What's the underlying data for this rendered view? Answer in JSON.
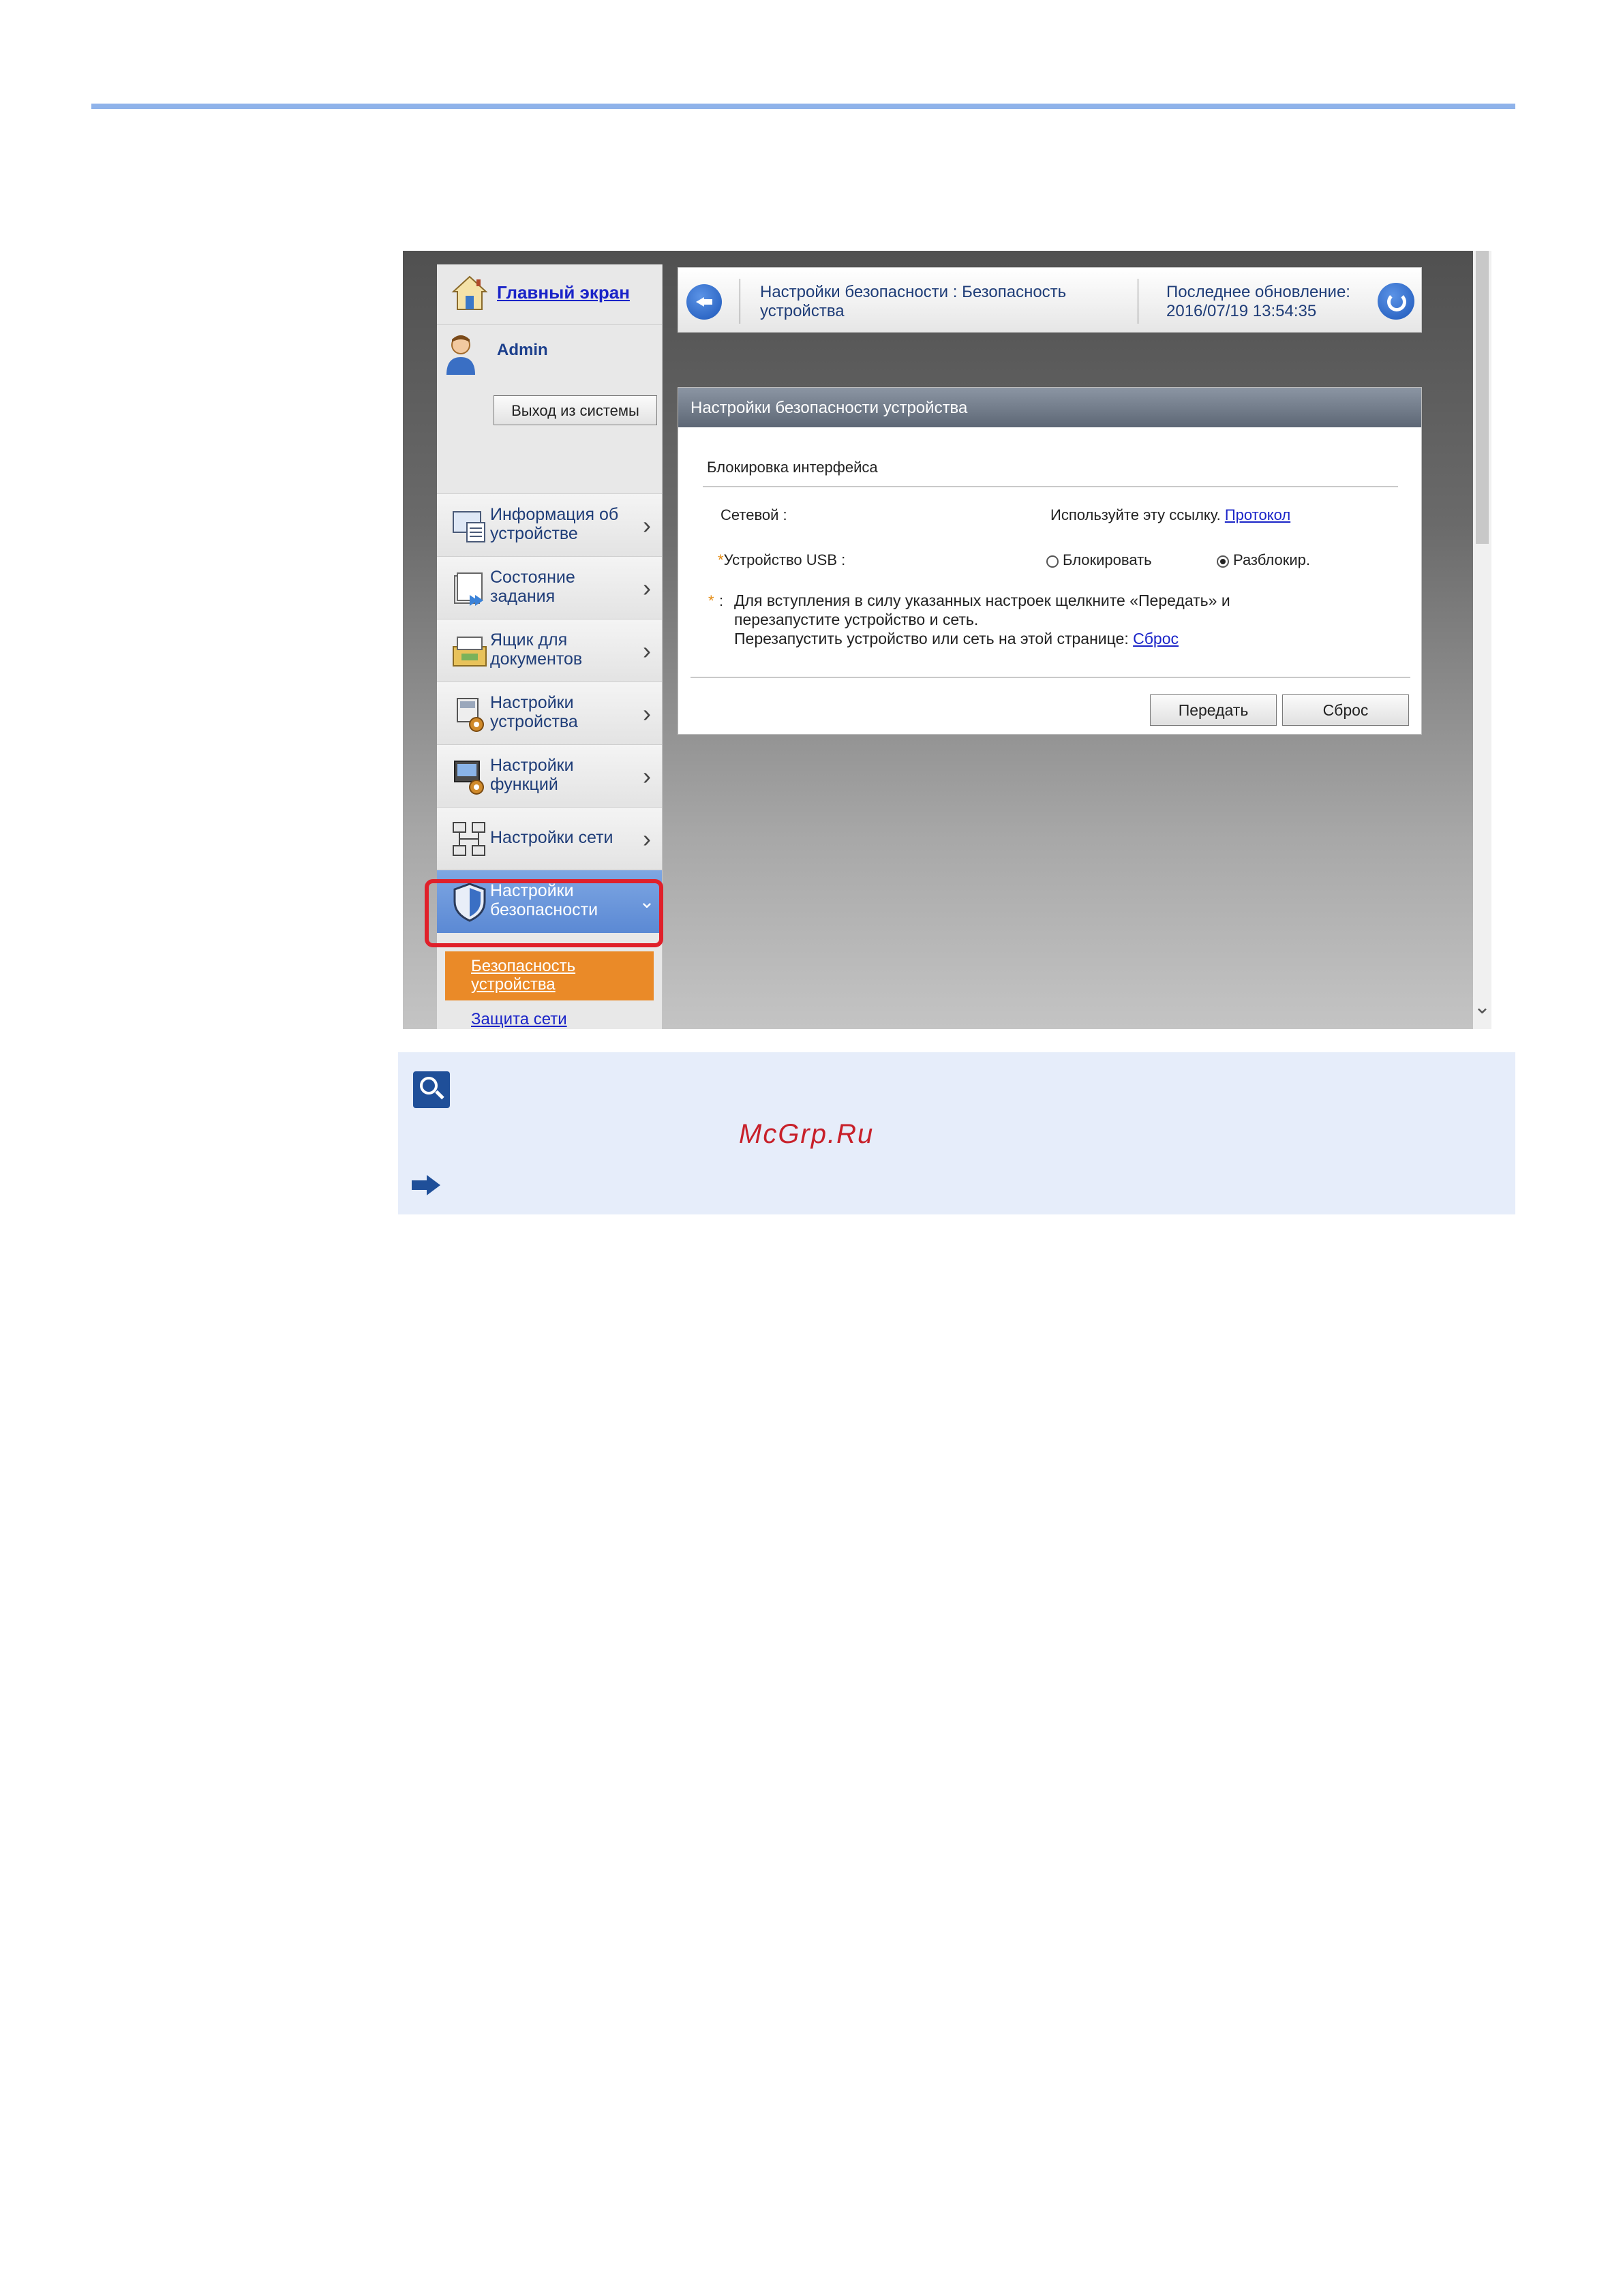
{
  "sidebar": {
    "home_link": "Главный экран",
    "user_name": "Admin",
    "logout_label": "Выход из системы",
    "items": [
      {
        "label": "Информация об устройстве"
      },
      {
        "label": "Состояние задания"
      },
      {
        "label": "Ящик для документов"
      },
      {
        "label": "Настройки устройства"
      },
      {
        "label": "Настройки функций"
      },
      {
        "label": "Настройки сети"
      },
      {
        "label": "Настройки безопасности"
      }
    ],
    "sub_items": [
      {
        "label": "Безопасность устройства"
      },
      {
        "label": "Защита сети"
      }
    ]
  },
  "header": {
    "title": "Настройки безопасности : Безопасность устройства",
    "last_update": "Последнее обновление: 2016/07/19 13:54:35"
  },
  "panel": {
    "title": "Настройки безопасности устройства",
    "section": "Блокировка интерфейса",
    "network_label": "Сетевой :",
    "network_hint": "Используйте эту ссылку.",
    "network_link": "Протокол",
    "usb_star": "*",
    "usb_label": "Устройство USB :",
    "usb_option_block": "Блокировать",
    "usb_option_unblock": "Разблокир.",
    "usb_selected": "Разблокир.",
    "note_star": "*",
    "note_colon": ":",
    "note_line1": "Для вступления в силу указанных настроек щелкните «Передать» и",
    "note_line2": "перезапустите устройство и сеть.",
    "note_line3": "Перезапустить устройство или сеть на этой странице:",
    "note_reset_link": "Сброс",
    "submit_label": "Передать",
    "reset_label": "Сброс"
  },
  "note_box": {
    "watermark": "McGrp.Ru"
  },
  "colors": {
    "accent_rule": "#8fb3ea",
    "highlight": "#e0202a",
    "active_sub": "#ea8a28",
    "link": "#1a24c8",
    "note_bg": "#e6edfa"
  },
  "icons": [
    "house-icon",
    "user-icon",
    "device-info-icon",
    "job-status-icon",
    "document-box-icon",
    "device-settings-icon",
    "function-settings-icon",
    "network-settings-icon",
    "security-shield-icon",
    "back-arrow-icon",
    "refresh-icon",
    "magnifier-note-icon",
    "right-arrow-icon"
  ]
}
